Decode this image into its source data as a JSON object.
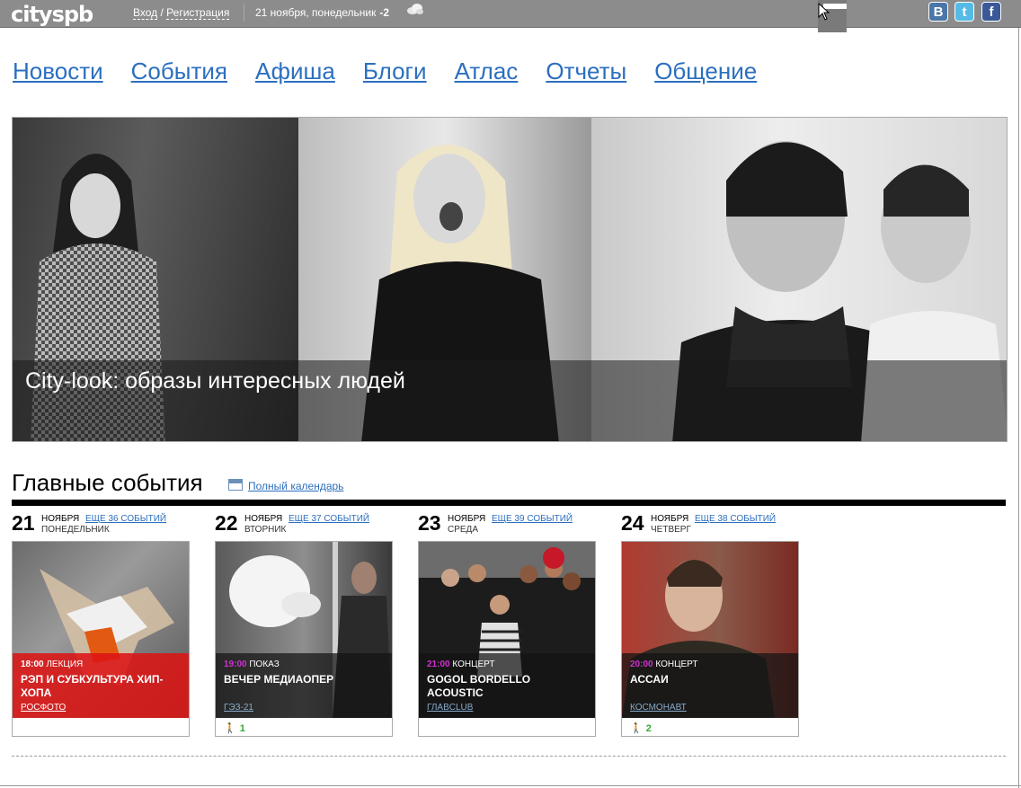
{
  "topbar": {
    "logo": "cityspb",
    "login": "Вход",
    "slash": " / ",
    "register": "Регистрация",
    "date": "21 ноября, понедельник",
    "temperature": "-2",
    "weather_icon": "cloud-icon",
    "social": {
      "vk": "B",
      "twitter": "t",
      "facebook": "f"
    }
  },
  "nav": [
    "Новости",
    "События",
    "Афиша",
    "Блоги",
    "Атлас",
    "Отчеты",
    "Общение"
  ],
  "hero": {
    "caption": "City-look: образы интересных людей"
  },
  "events": {
    "title": "Главные события",
    "calendar_link": "Полный календарь",
    "days": [
      {
        "num": "21",
        "month": "ноября",
        "weekday": "понедельник",
        "more": "еще 36 событий",
        "card": {
          "time": "18:00",
          "kind": "лекция",
          "title": "Рэп и субкультура хип-хопа",
          "venue": "Росфото",
          "stats": "",
          "style": "red"
        }
      },
      {
        "num": "22",
        "month": "ноября",
        "weekday": "вторник",
        "more": "еще 37 событий",
        "card": {
          "time": "19:00",
          "kind": "показ",
          "title": "Вечер медиаопер",
          "venue": "ГЭЗ-21",
          "stats": "1",
          "style": "dark"
        }
      },
      {
        "num": "23",
        "month": "ноября",
        "weekday": "среда",
        "more": "еще 39 событий",
        "card": {
          "time": "21:00",
          "kind": "концерт",
          "title": "Gogol Bordello Acoustic",
          "venue": "ГлавClub",
          "stats": "",
          "style": "dark"
        }
      },
      {
        "num": "24",
        "month": "ноября",
        "weekday": "четверг",
        "more": "еще 38 событий",
        "card": {
          "time": "20:00",
          "kind": "концерт",
          "title": "Ассаи",
          "venue": "Космонавт",
          "stats": "2",
          "style": "dark"
        }
      }
    ]
  },
  "colors": {
    "link": "#2b6fbf",
    "topbar": "#8c8c8c",
    "accent_time": "#cc33cc",
    "red_band": "#dc1414"
  }
}
